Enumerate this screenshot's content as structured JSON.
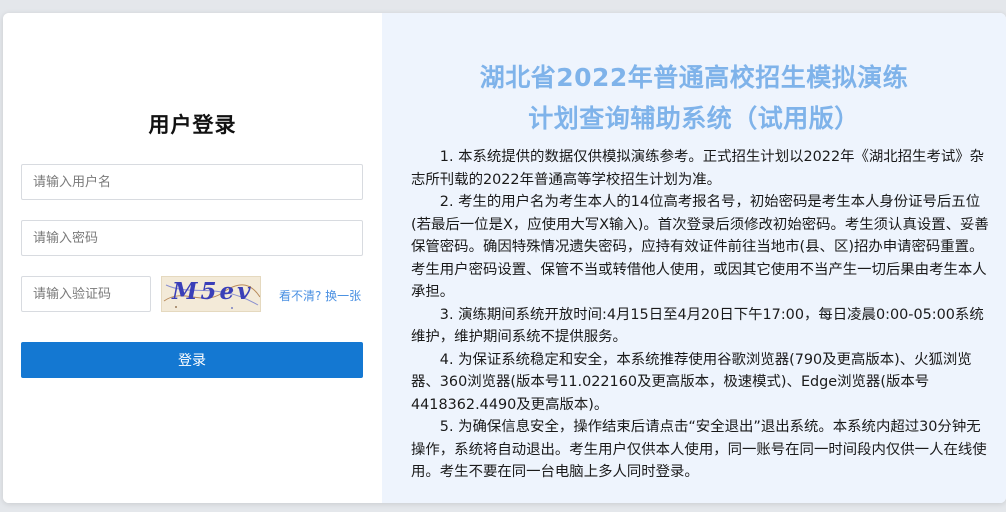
{
  "login": {
    "title": "用户登录",
    "username_placeholder": "请输入用户名",
    "password_placeholder": "请输入密码",
    "captcha_placeholder": "请输入验证码",
    "captcha_text": "M5ev",
    "refresh_link": "看不清? 换一张",
    "submit_label": "登录"
  },
  "system": {
    "title_line1": "湖北省2022年普通高校招生模拟演练",
    "title_line2": "计划查询辅助系统（试用版）",
    "notices": [
      "1. 本系统提供的数据仅供模拟演练参考。正式招生计划以2022年《湖北招生考试》杂志所刊载的2022年普通高等学校招生计划为准。",
      "2. 考生的用户名为考生本人的14位高考报名号，初始密码是考生本人身份证号后五位(若最后一位是X，应使用大写X输入)。首次登录后须修改初始密码。考生须认真设置、妥善保管密码。确因特殊情况遗失密码，应持有效证件前往当地市(县、区)招办申请密码重置。考生用户密码设置、保管不当或转借他人使用，或因其它使用不当产生一切后果由考生本人承担。",
      "3. 演练期间系统开放时间:4月15日至4月20日下午17:00，每日凌晨0:00-05:00系统维护，维护期间系统不提供服务。",
      "4. 为保证系统稳定和安全，本系统推荐使用谷歌浏览器(790及更高版本)、火狐浏览器、360浏览器(版本号11.022160及更高版本，极速模式)、Edge浏览器(版本号4418362.4490及更高版本)。",
      "5. 为确保信息安全，操作结束后请点击“安全退出”退出系统。本系统内超过30分钟无操作，系统将自动退出。考生用户仅供本人使用，同一账号在同一时间段内仅供一人在线使用。考生不要在同一台电脑上多人同时登录。"
    ]
  },
  "colors": {
    "primary_button": "#1478d2",
    "title_blue": "#7fb3ea",
    "link_blue": "#4a90e2",
    "right_panel_bg": "#eef4fd"
  }
}
